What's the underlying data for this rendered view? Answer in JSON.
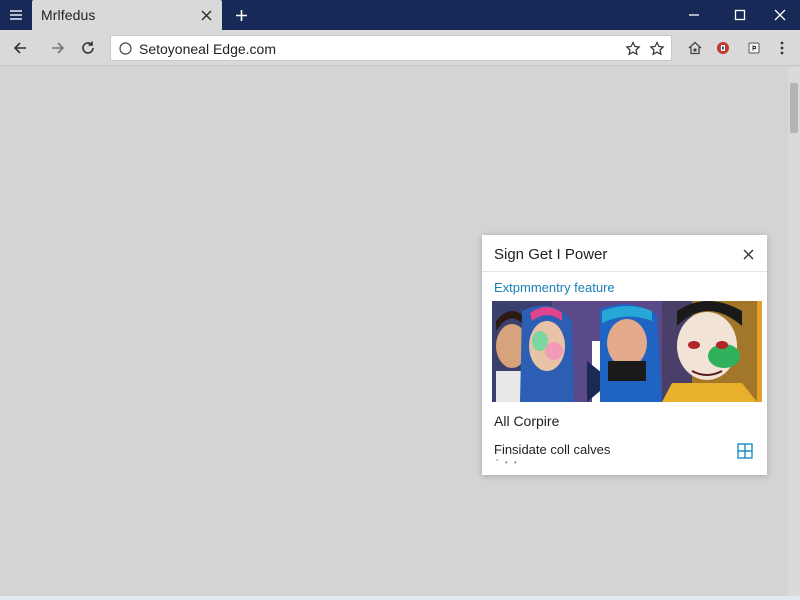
{
  "browser": {
    "tab": {
      "title": "Mrlfedus"
    },
    "address": {
      "url": "Setoyoneal Edge.com"
    }
  },
  "popup": {
    "title": "Sign Get I Power",
    "subtitle": "Extpmmentry feature",
    "item_primary": "All Corpire",
    "item_secondary": "Finsidate coll calves",
    "item_secondary_sub": "“ • •"
  },
  "icons": {
    "menu": "hamburger-icon",
    "tab_close": "close-icon",
    "new_tab": "plus-icon",
    "minimize": "minimize-icon",
    "maximize": "maximize-icon",
    "close": "close-icon",
    "back": "arrow-left-icon",
    "forward": "arrow-right-icon",
    "refresh": "refresh-icon",
    "site_info": "info-circle-icon",
    "favorite": "star-icon",
    "favorites": "star-outline-icon",
    "extensions": [
      "home-extension-icon",
      "shield-extension-icon",
      "bookmark-extension-icon"
    ],
    "more": "more-vertical-icon",
    "popup_grid": "grid-icon"
  },
  "colors": {
    "title_bar": "#172a57",
    "toolbar": "#d9d9d9",
    "page_background": "#d4d4d4",
    "accent_link": "#1a7fb8",
    "extension_red": "#c0392b"
  }
}
